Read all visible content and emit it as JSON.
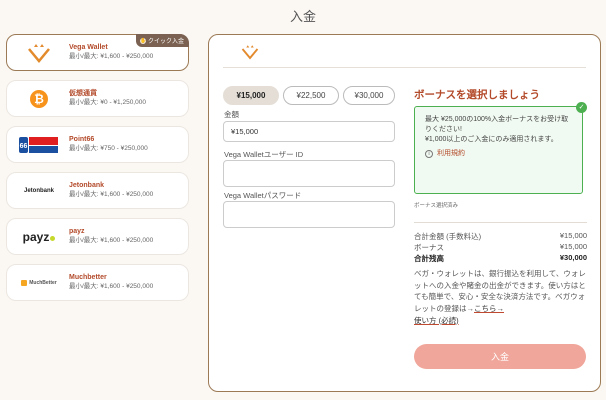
{
  "page": {
    "title": "入金"
  },
  "methods": [
    {
      "name": "Vega Wallet",
      "limit": "最小/最大: ¥1,600 - ¥250,000",
      "badge": "クイック入金",
      "logo": "vega-logo"
    },
    {
      "name": "仮想通貨",
      "limit": "最小/最大: ¥0 - ¥1,250,000",
      "logo": "bitcoin-logo"
    },
    {
      "name": "Point66",
      "limit": "最小/最大: ¥750 - ¥250,000",
      "logo": "point66-logo"
    },
    {
      "name": "Jetonbank",
      "limit": "最小/最大: ¥1,600 - ¥250,000",
      "logo_text": "Jetonbank",
      "logo": "jetonbank-logo"
    },
    {
      "name": "payz",
      "limit": "最小/最大: ¥1,600 - ¥250,000",
      "logo_text": "payz",
      "logo": "payz-logo"
    },
    {
      "name": "Muchbetter",
      "limit": "最小/最大: ¥1,600 - ¥250,000",
      "logo_text": "MuchBetter",
      "logo": "muchbetter-logo"
    }
  ],
  "form": {
    "amounts": [
      "¥15,000",
      "¥22,500",
      "¥30,000"
    ],
    "amount_label": "金額",
    "amount_value": "¥15,000",
    "user_label": "Vega Walletユーザー ID",
    "user_value": "",
    "password_label": "Vega Walletパスワード",
    "password_value": ""
  },
  "bonus": {
    "title": "ボーナスを選択しましょう",
    "line1": "最大 ¥25,000の100%入金ボーナスをお受け取りください!",
    "line2": "¥1,000以上のご入金にのみ適用されます。",
    "terms": "利用規約",
    "no_bonus": "ボーナス選択済み"
  },
  "summary": {
    "total_label": "合計金額 (手数料込)",
    "total_value": "¥15,000",
    "bonus_label": "ボーナス",
    "bonus_value": "¥15,000",
    "balance_label": "合計残高",
    "balance_value": "¥30,000"
  },
  "description": {
    "text": "ベガ・ウォレットは、銀行振込を利用して、ウォレットへの入金や賭金の出金ができます。使い方はとても簡単で、安心・安全な決済方法です。ベガウォレットの登録は→",
    "link1": "こちら→",
    "link2": "使い方 (必読)"
  },
  "submit_label": "入金",
  "colors": {
    "accent": "#b34a2a",
    "border": "#9b7a55",
    "button": "#f0a69a",
    "success": "#4caf50"
  }
}
